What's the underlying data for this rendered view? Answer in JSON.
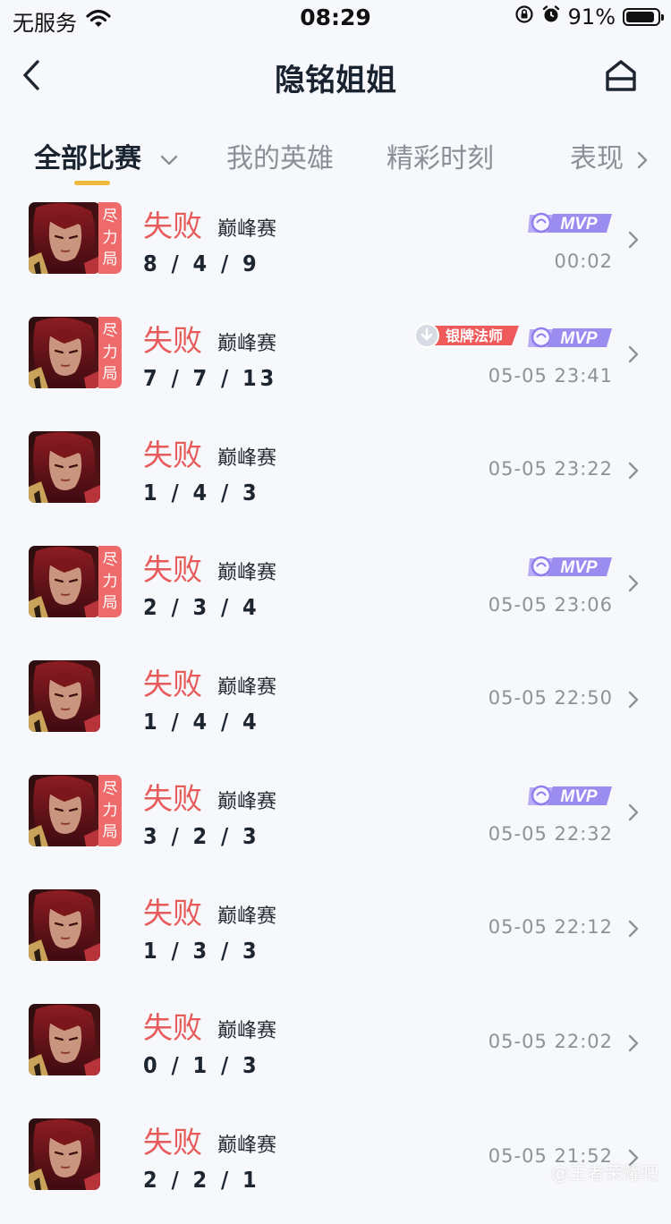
{
  "status_bar": {
    "carrier": "无服务",
    "time": "08:29",
    "battery": "91%",
    "battery_level": 0.91
  },
  "navbar": {
    "title": "隐铭姐姐"
  },
  "tabs": [
    {
      "label": "全部比赛"
    },
    {
      "label": "我的英雄"
    },
    {
      "label": "精彩时刻"
    },
    {
      "label": "表现"
    }
  ],
  "tag_text": [
    "尽",
    "力",
    "局"
  ],
  "badges": {
    "mvp": "MVP",
    "silver": "银牌法师"
  },
  "matches": [
    {
      "result": "失败",
      "mode": "巅峰赛",
      "kda": "8 / 4 / 9",
      "time": "00:02",
      "tag": true,
      "mvp": true,
      "silver": false
    },
    {
      "result": "失败",
      "mode": "巅峰赛",
      "kda": "7 / 7 / 13",
      "time": "05-05 23:41",
      "tag": true,
      "mvp": true,
      "silver": true
    },
    {
      "result": "失败",
      "mode": "巅峰赛",
      "kda": "1 / 4 / 3",
      "time": "05-05 23:22",
      "tag": false,
      "mvp": false,
      "silver": false
    },
    {
      "result": "失败",
      "mode": "巅峰赛",
      "kda": "2 / 3 / 4",
      "time": "05-05 23:06",
      "tag": true,
      "mvp": true,
      "silver": false
    },
    {
      "result": "失败",
      "mode": "巅峰赛",
      "kda": "1 / 4 / 4",
      "time": "05-05 22:50",
      "tag": false,
      "mvp": false,
      "silver": false
    },
    {
      "result": "失败",
      "mode": "巅峰赛",
      "kda": "3 / 2 / 3",
      "time": "05-05 22:32",
      "tag": true,
      "mvp": true,
      "silver": false
    },
    {
      "result": "失败",
      "mode": "巅峰赛",
      "kda": "1 / 3 / 3",
      "time": "05-05 22:12",
      "tag": false,
      "mvp": false,
      "silver": false
    },
    {
      "result": "失败",
      "mode": "巅峰赛",
      "kda": "0 / 1 / 3",
      "time": "05-05 22:02",
      "tag": false,
      "mvp": false,
      "silver": false
    },
    {
      "result": "失败",
      "mode": "巅峰赛",
      "kda": "2 / 2 / 1",
      "time": "05-05 21:52",
      "tag": false,
      "mvp": false,
      "silver": false
    }
  ],
  "watermark": "@王者荣耀吧",
  "colors": {
    "loss": "#e85b5b",
    "tag": "#ef6a6a",
    "tab_underline": "#f1b93a",
    "mvp": "#9b8cf0",
    "silver_badge": "#ef5b5b"
  }
}
